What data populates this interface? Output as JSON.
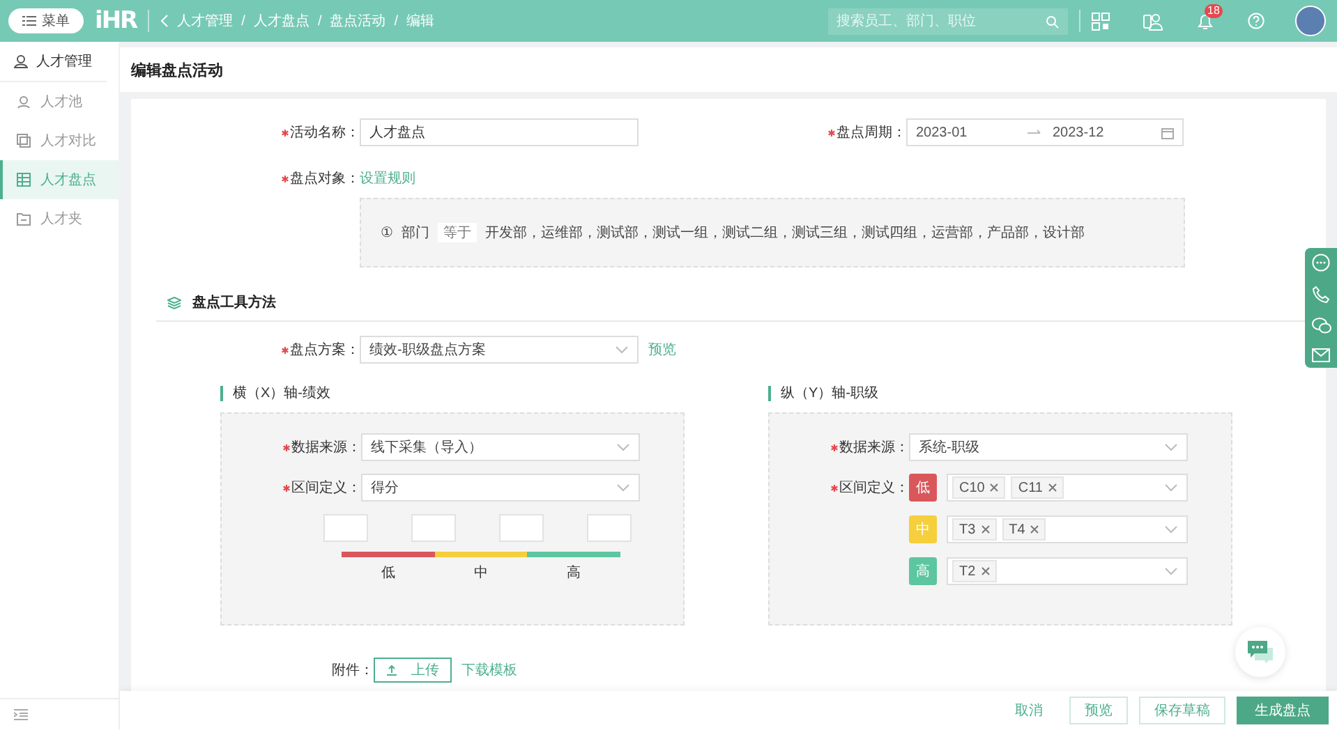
{
  "topbar": {
    "menu_button": "菜单",
    "logo": "iHR",
    "breadcrumb": [
      "人才管理",
      "人才盘点",
      "盘点活动",
      "编辑"
    ],
    "breadcrumb_separator": "/",
    "search": {
      "placeholder": "搜索员工、部门、职位"
    },
    "notification_badge": "18"
  },
  "sidebar": {
    "header": "人才管理",
    "items": [
      {
        "label": "人才池",
        "selected": false
      },
      {
        "label": "人才对比",
        "selected": false
      },
      {
        "label": "人才盘点",
        "selected": true
      },
      {
        "label": "人才夹",
        "selected": false
      }
    ]
  },
  "page_title": "编辑盘点活动",
  "form": {
    "name": {
      "label": "活动名称：",
      "required": true,
      "value": "人才盘点"
    },
    "period": {
      "label": "盘点周期：",
      "required": true,
      "start": "2023-01",
      "end": "2023-12"
    },
    "target": {
      "label": "盘点对象：",
      "required": true,
      "link": "设置规则",
      "rule": {
        "index": "①",
        "field": "部门",
        "operator": "等于",
        "value": "开发部，运维部，测试部，测试一组，测试二组，测试三组，测试四组，运营部，产品部，设计部"
      }
    },
    "section_title": "盘点工具方法",
    "scheme": {
      "label": "盘点方案：",
      "required": true,
      "value": "绩效-职级盘点方案",
      "link": "预览"
    },
    "x_axis": {
      "title": "横（X）轴-绩效",
      "source": {
        "label": "数据来源：",
        "required": true,
        "value": "线下采集（导入）"
      },
      "interval": {
        "label": "区间定义：",
        "required": true,
        "value": "得分"
      },
      "levels": [
        {
          "label": "低",
          "color": "#d9575b"
        },
        {
          "label": "中",
          "color": "#f5cf3c"
        },
        {
          "label": "高",
          "color": "#5cc6a0"
        }
      ]
    },
    "y_axis": {
      "title": "纵（Y）轴-职级",
      "source": {
        "label": "数据来源：",
        "required": true,
        "value": "系统-职级"
      },
      "interval_label": "区间定义：",
      "interval_required": true,
      "levels": [
        {
          "label": "低",
          "color": "#d9575b",
          "tags": [
            "C10",
            "C11"
          ]
        },
        {
          "label": "中",
          "color": "#f5cf3c",
          "tags": [
            "T3",
            "T4"
          ]
        },
        {
          "label": "高",
          "color": "#5cc6a0",
          "tags": [
            "T2"
          ]
        }
      ]
    },
    "attachment": {
      "label": "附件：",
      "upload": "上传",
      "template_link": "下载模板"
    }
  },
  "footer_buttons": [
    {
      "label": "取消",
      "kind": "text"
    },
    {
      "label": "预览",
      "kind": "outline"
    },
    {
      "label": "保存草稿",
      "kind": "outline"
    },
    {
      "label": "生成盘点",
      "kind": "primary"
    }
  ]
}
